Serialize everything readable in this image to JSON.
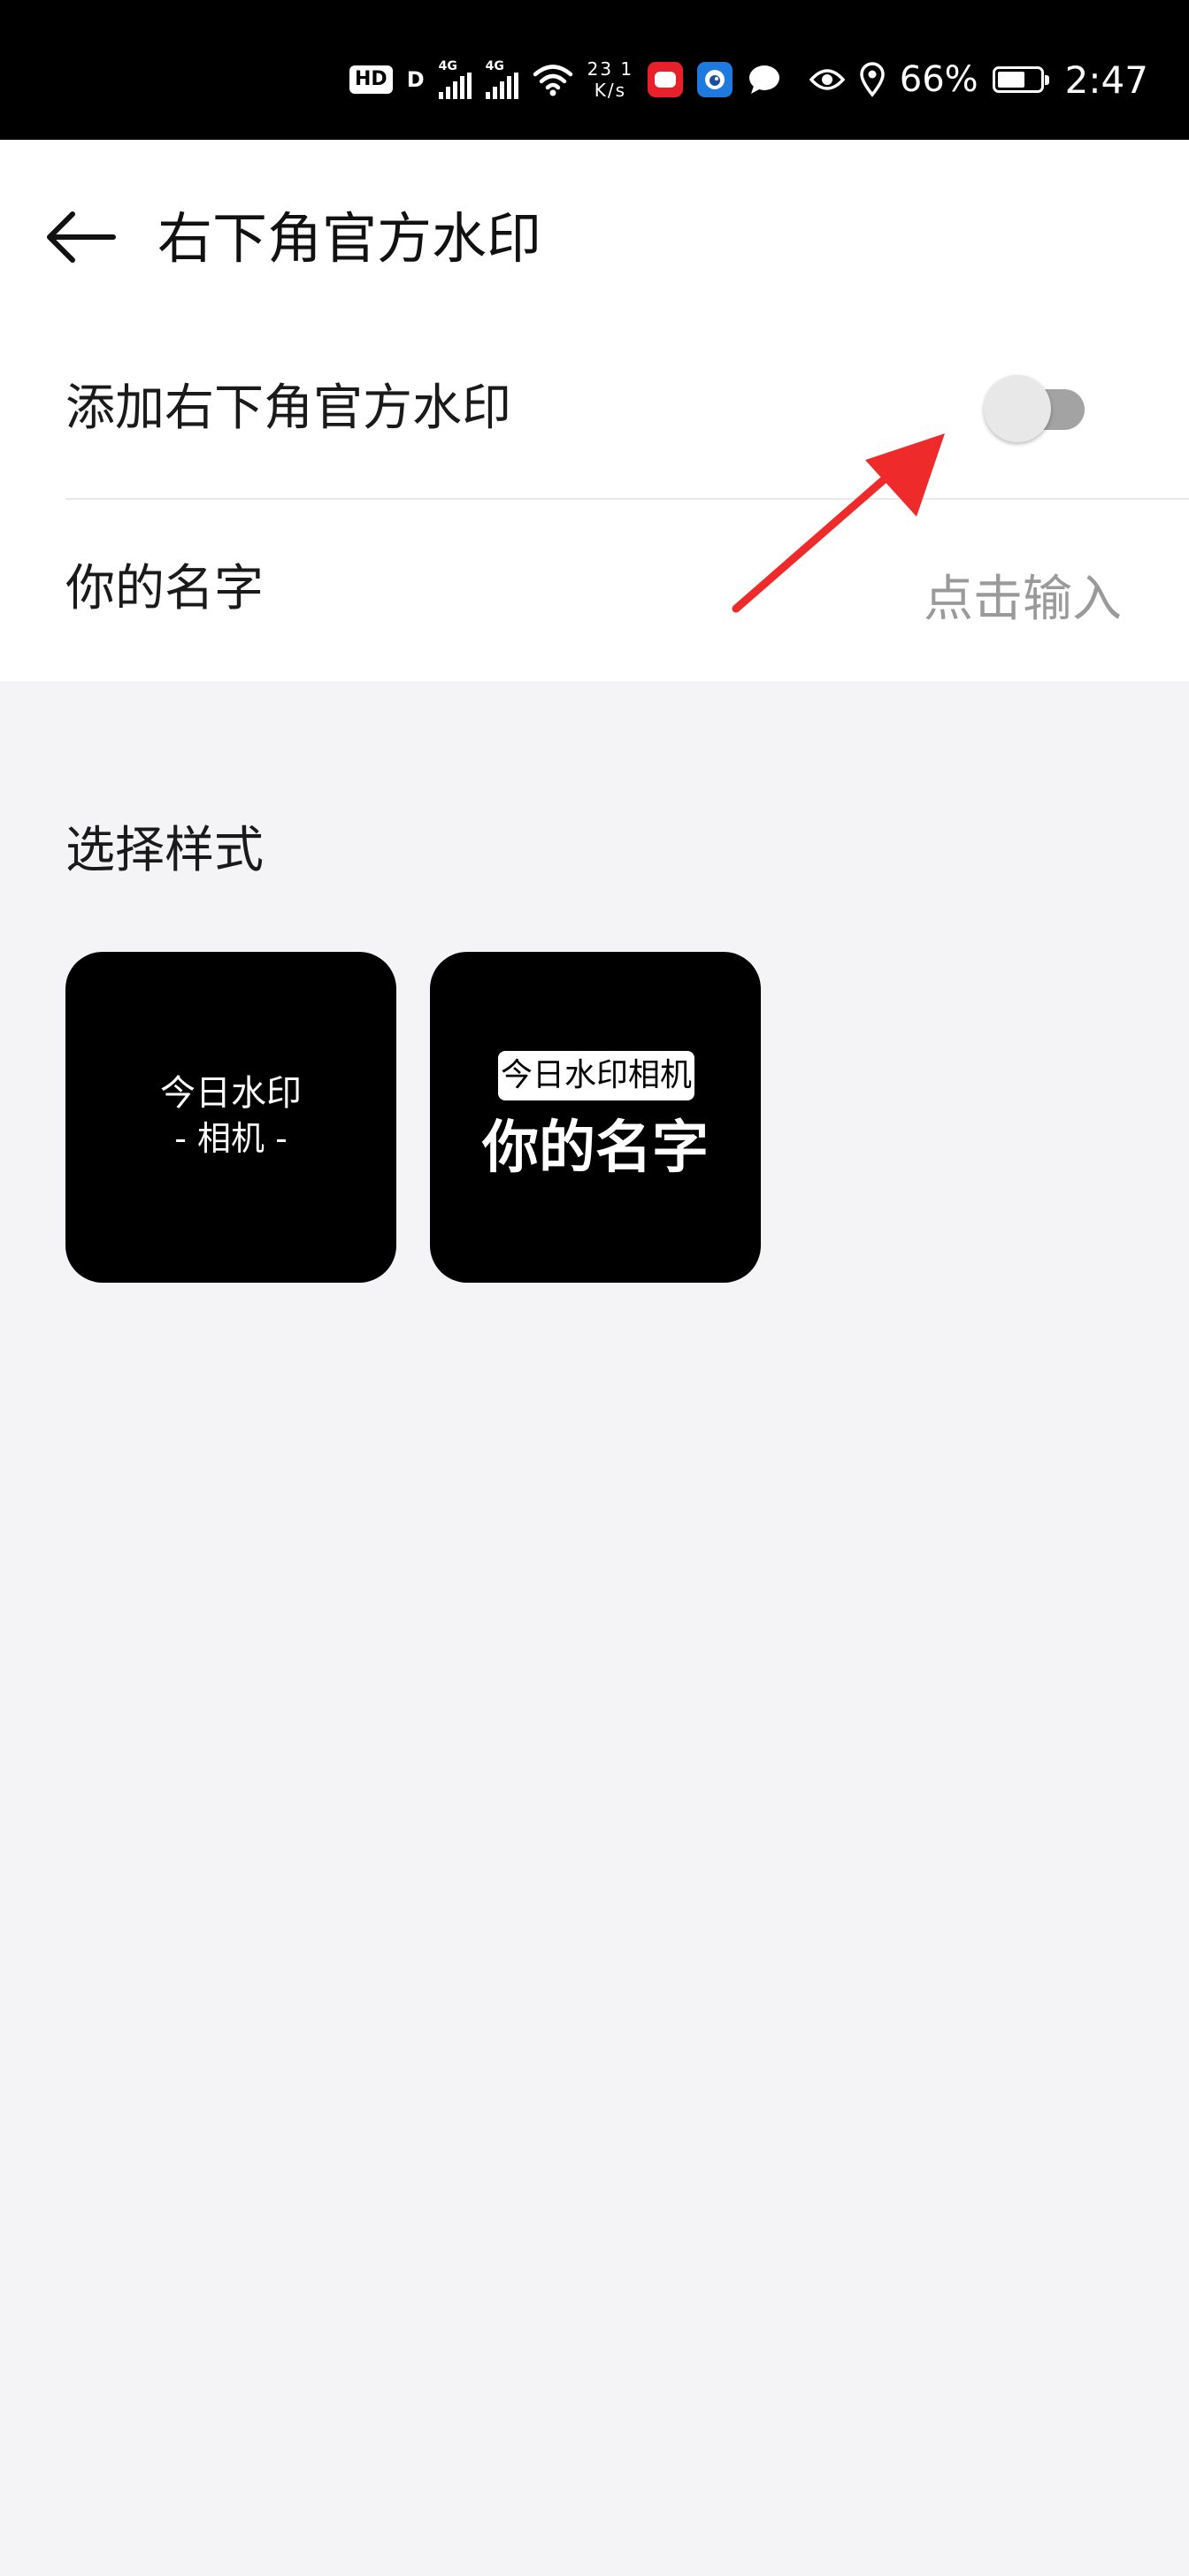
{
  "status_bar": {
    "hd_label": "HD",
    "hd_sub": "D",
    "sim1_type": "4G",
    "sim2_type": "4G",
    "speed_value": "23 1",
    "speed_unit": "K/s",
    "battery_percent": "66%",
    "battery_level": 0.66,
    "time": "2:47",
    "icons": [
      "signal-icon",
      "wifi-icon",
      "app-notification-icon",
      "bluetooth-icon",
      "chat-icon",
      "eye-icon",
      "location-icon",
      "battery-icon"
    ]
  },
  "header": {
    "title": "右下角官方水印"
  },
  "settings": {
    "toggle_label": "添加右下角官方水印",
    "toggle_on": false,
    "name_label": "你的名字",
    "name_placeholder": "点击输入"
  },
  "styles": {
    "section_title": "选择样式",
    "options": [
      {
        "line1": "今日水印",
        "line2": "- 相机 -"
      },
      {
        "badge": "今日水印相机",
        "name": "你的名字"
      }
    ]
  },
  "colors": {
    "accent_arrow": "#ee2a2a",
    "toggle_track": "#a3a3a3",
    "toggle_knob": "#e8e8e8",
    "background": "#f4f4f6"
  }
}
